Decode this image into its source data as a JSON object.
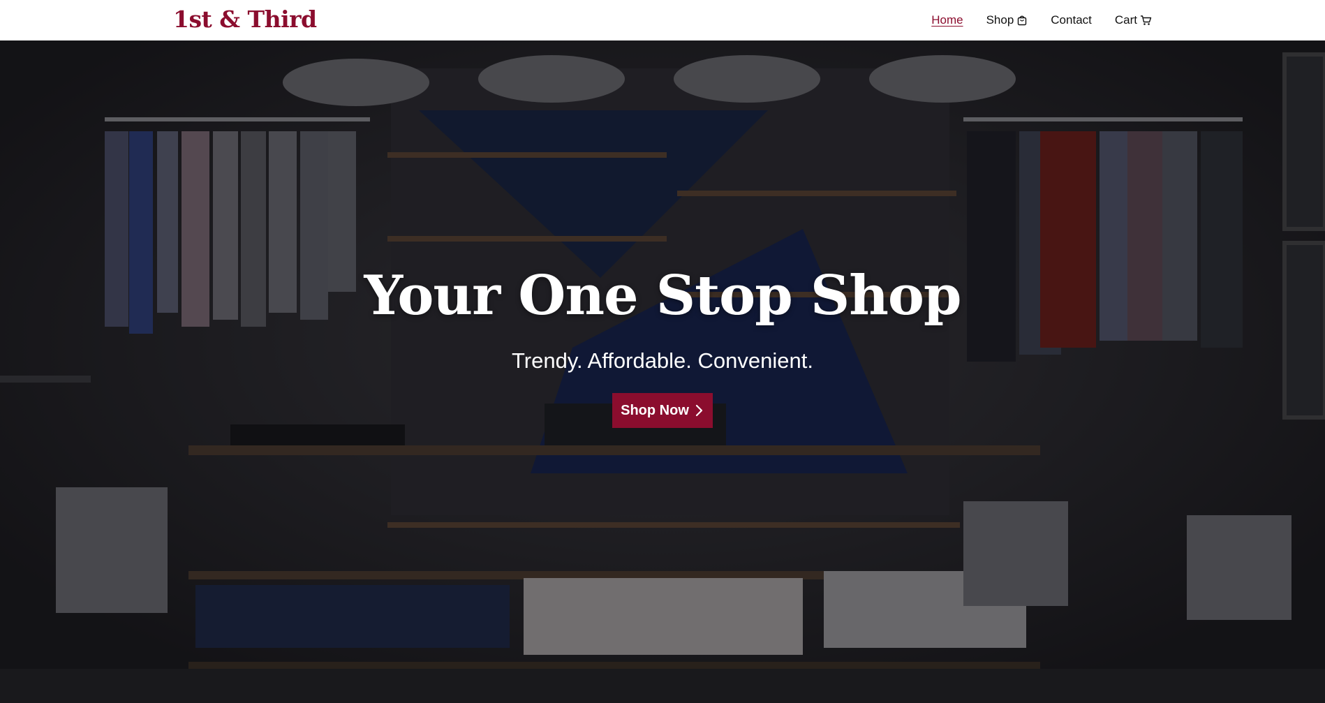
{
  "header": {
    "logo": "1st & Third",
    "nav": [
      {
        "label": "Home",
        "active": true
      },
      {
        "label": "Shop",
        "icon": "shopping-bag-icon"
      },
      {
        "label": "Contact"
      },
      {
        "label": "Cart",
        "icon": "cart-icon"
      }
    ]
  },
  "hero": {
    "title": "Your One Stop Shop",
    "subtitle": "Trendy. Affordable. Convenient.",
    "cta_label": "Shop Now",
    "cta_icon": "chevron-right-icon"
  },
  "colors": {
    "brand": "#8b0d2e",
    "header_bg": "#ffffff",
    "hero_overlay": "#1e1d1f"
  }
}
